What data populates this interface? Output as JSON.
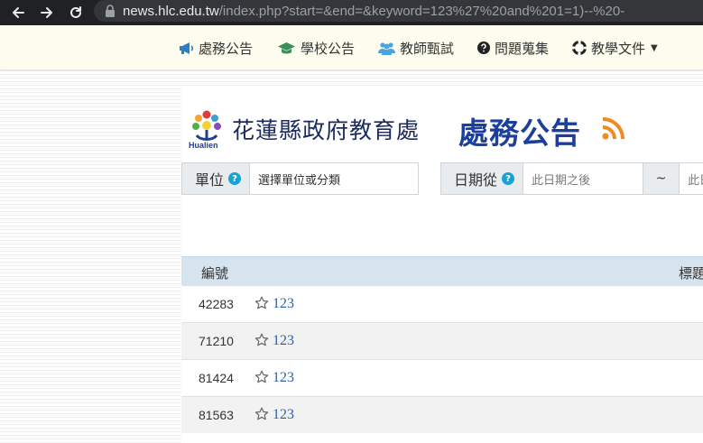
{
  "browser": {
    "url_host": "news.hlc.edu.tw",
    "url_path": "/index.php?start=&end=&keyword=123%27%20and%201=1)--%20-"
  },
  "nav": {
    "items": [
      {
        "label": "處務公告",
        "icon": "bullhorn-icon",
        "color": "#2e7fc1"
      },
      {
        "label": "學校公告",
        "icon": "graduation-cap-icon",
        "color": "#3a8f5a"
      },
      {
        "label": "教師甄試",
        "icon": "users-icon",
        "color": "#4aa3df"
      },
      {
        "label": "問題蒐集",
        "icon": "question-circle-icon",
        "color": "#222222"
      },
      {
        "label": "教學文件",
        "icon": "life-ring-icon",
        "color": "#222222"
      }
    ]
  },
  "header": {
    "logo_text": "Hualien",
    "org_name": "花蓮縣政府教育處",
    "page_title": "處務公告"
  },
  "filters": {
    "unit_label": "單位",
    "unit_value": "選擇單位或分類",
    "date_label": "日期從",
    "date_from_placeholder": "此日期之後",
    "tilde": "~",
    "date_to_placeholder": "此日"
  },
  "table": {
    "columns": [
      "編號",
      "標題"
    ],
    "rows": [
      {
        "id": "42283",
        "title": "123"
      },
      {
        "id": "71210",
        "title": "123"
      },
      {
        "id": "81424",
        "title": "123"
      },
      {
        "id": "81563",
        "title": "123"
      }
    ]
  },
  "colors": {
    "nav_bg": "#fdfdef",
    "title_blue": "#1b3f9a",
    "link_blue": "#2f5ea8",
    "thead_bg": "#d6e4f0",
    "rss_orange": "#f08a24"
  }
}
